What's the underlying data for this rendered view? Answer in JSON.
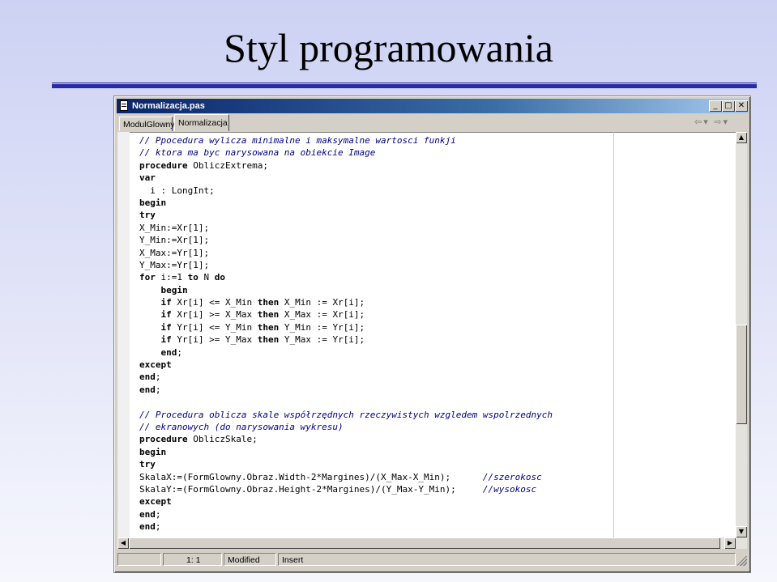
{
  "slide": {
    "title": "Styl programowania"
  },
  "window": {
    "title": "Normalizacja.pas",
    "controls": {
      "minimize": "_",
      "maximize": "□",
      "close": "✕"
    }
  },
  "tabs": [
    {
      "label": "ModulGlowny",
      "active": false
    },
    {
      "label": "Normalizacja",
      "active": true
    }
  ],
  "nav": {
    "back": "⇦",
    "back_dropdown": "▾",
    "forward": "⇨",
    "forward_dropdown": "▾"
  },
  "code": {
    "lines": [
      "// Ppocedura wylicza minimalne i maksymalne wartosci funkji",
      "// ktora ma byc narysowana na obiekcie Image",
      "procedure ObliczExtrema;",
      "var",
      "  i : LongInt;",
      "begin",
      "try",
      "X_Min:=Xr[1];",
      "Y_Min:=Xr[1];",
      "X_Max:=Yr[1];",
      "Y_Max:=Yr[1];",
      "for i:=1 to N do",
      "    begin",
      "    if Xr[i] <= X_Min then X_Min := Xr[i];",
      "    if Xr[i] >= X_Max then X_Max := Xr[i];",
      "    if Yr[i] <= Y_Min then Y_Min := Yr[i];",
      "    if Yr[i] >= Y_Max then Y_Max := Yr[i];",
      "    end;",
      "except",
      "end;",
      "end;",
      "",
      "// Procedura oblicza skale współrzędnych rzeczywistych wzgledem wspolrzednych",
      "// ekranowych (do narysowania wykresu)",
      "procedure ObliczSkale;",
      "begin",
      "try",
      "SkalaX:=(FormGlowny.Obraz.Width-2*Margines)/(X_Max-X_Min);      //szerokosc",
      "SkalaY:=(FormGlowny.Obraz.Height-2*Margines)/(Y_Max-Y_Min);     //wysokosc",
      "except",
      "end;",
      "end;"
    ]
  },
  "scroll": {
    "up": "▲",
    "down": "▼",
    "left": "◀",
    "right": "▶"
  },
  "status": {
    "blank": "",
    "position": "1:  1",
    "modified": "Modified",
    "mode": "Insert"
  }
}
